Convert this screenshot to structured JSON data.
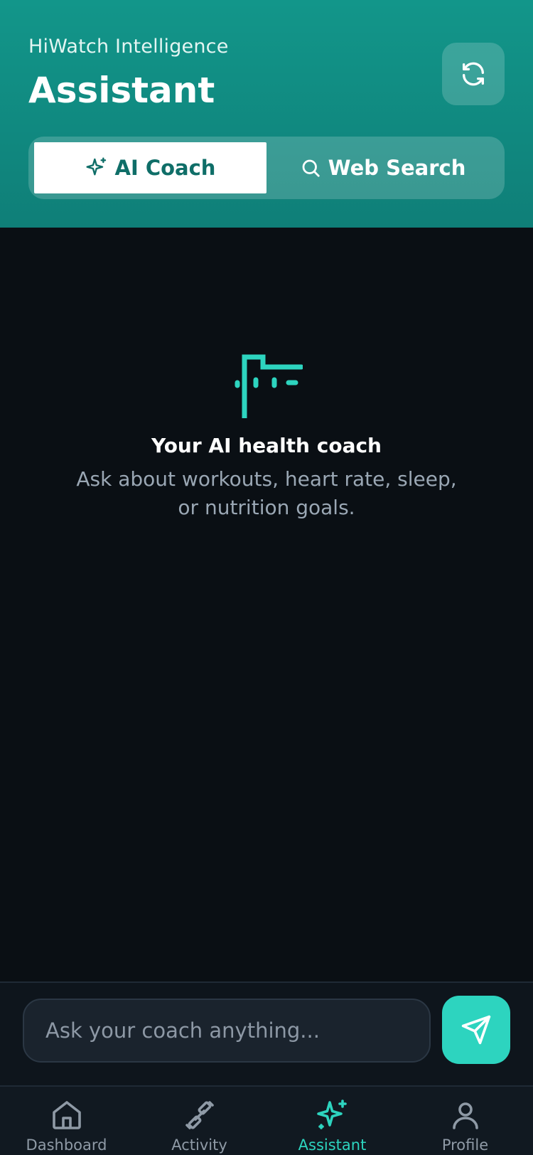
{
  "header": {
    "subtitle": "HiWatch Intelligence",
    "title": "Assistant",
    "refresh_icon": "refresh-icon"
  },
  "segments": [
    {
      "label": "AI Coach",
      "icon": "sparkles-icon",
      "active": true
    },
    {
      "label": "Web Search",
      "icon": "search-icon",
      "active": false
    }
  ],
  "empty_state": {
    "icon": "coach-icon",
    "title": "Your AI health coach",
    "description": "Ask about workouts, heart rate, sleep, or nutrition goals."
  },
  "composer": {
    "placeholder": "Ask your coach anything...",
    "send_icon": "send-icon"
  },
  "tabbar": [
    {
      "label": "Dashboard",
      "icon": "home-icon",
      "active": false
    },
    {
      "label": "Activity",
      "icon": "dumbbell-icon",
      "active": false
    },
    {
      "label": "Assistant",
      "icon": "sparkles-icon",
      "active": true
    },
    {
      "label": "Profile",
      "icon": "user-icon",
      "active": false
    }
  ],
  "colors": {
    "header_gradient_top": "#12968a",
    "header_gradient_bottom": "#0f7f78",
    "accent": "#2dd4bf",
    "background": "#0a0f14"
  }
}
